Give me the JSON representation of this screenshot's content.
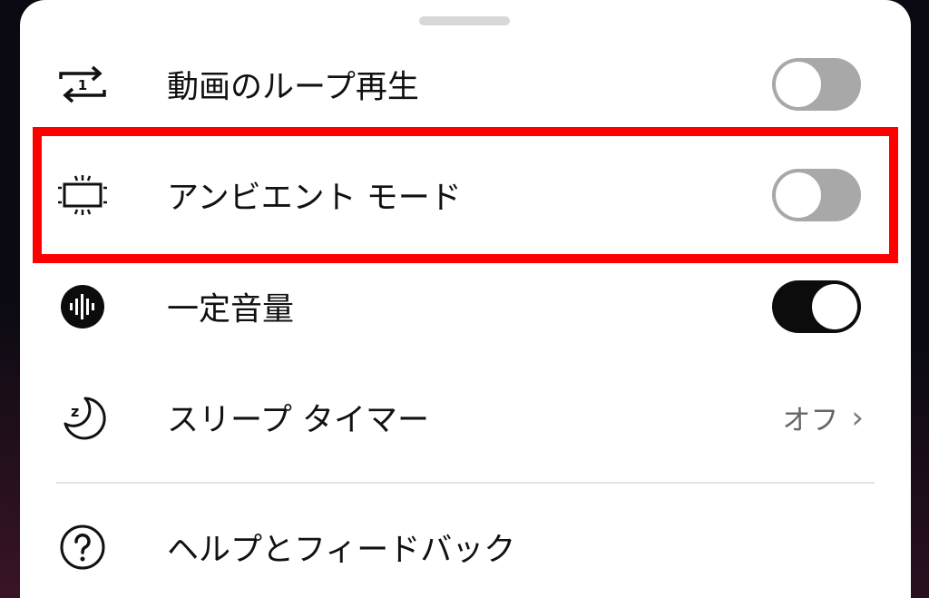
{
  "settings": {
    "loop": {
      "label": "動画のループ再生",
      "icon": "repeat-one-icon",
      "enabled": false
    },
    "ambient": {
      "label": "アンビエント モード",
      "icon": "ambient-mode-icon",
      "enabled": false
    },
    "stable_volume": {
      "label": "一定音量",
      "icon": "stable-volume-icon",
      "enabled": true
    },
    "sleep_timer": {
      "label": "スリープ タイマー",
      "icon": "sleep-timer-icon",
      "value": "オフ"
    },
    "help": {
      "label": "ヘルプとフィードバック",
      "icon": "help-icon"
    }
  },
  "colors": {
    "highlight": "#ff0000",
    "toggle_on": "#0c0c0c",
    "toggle_off": "#a8a8a8"
  }
}
